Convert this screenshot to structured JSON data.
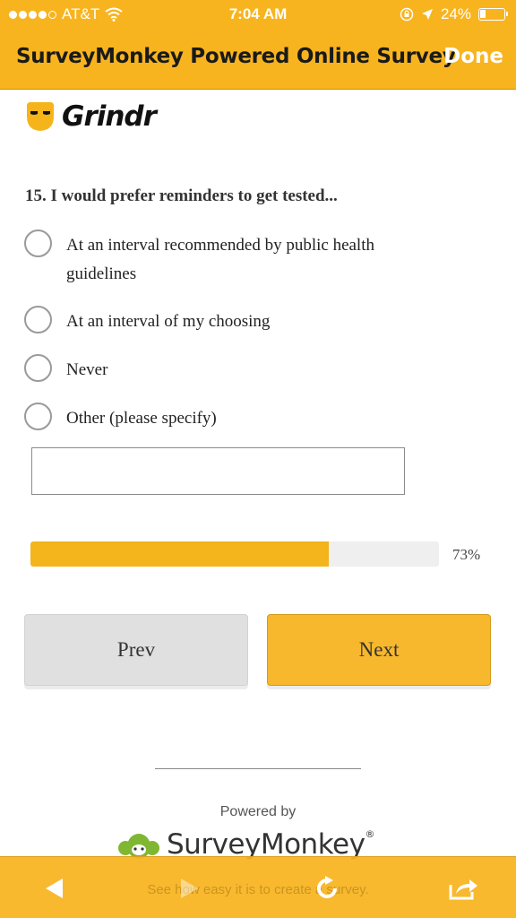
{
  "status_bar": {
    "carrier": "AT&T",
    "time": "7:04 AM",
    "battery_percent": "24%",
    "battery_level": 0.24,
    "signal_dots_filled": 4,
    "signal_dots_total": 5
  },
  "nav": {
    "title": "SurveyMonkey Powered Online Survey",
    "done_label": "Done"
  },
  "brand": {
    "logo_text": "Grindr"
  },
  "survey": {
    "question": "15. I would prefer reminders to get tested...",
    "options": [
      {
        "label": "At an interval recommended by public health guidelines",
        "selected": false
      },
      {
        "label": "At an interval of my choosing",
        "selected": false
      },
      {
        "label": "Never",
        "selected": false
      },
      {
        "label": "Other (please specify)",
        "selected": false
      }
    ],
    "other_input_value": ""
  },
  "progress": {
    "label": "73%",
    "fraction": 0.73
  },
  "buttons": {
    "prev_label": "Prev",
    "next_label": "Next"
  },
  "footer": {
    "powered_by": "Powered by",
    "brand_name": "SurveyMonkey",
    "reg_mark": "®"
  },
  "toolbar": {
    "ghost_text": "See how easy it is to create a survey."
  },
  "icons": {
    "wifi": "wifi-icon",
    "lock_rotation": "lock-rotation-icon",
    "location": "location-arrow-icon",
    "back": "back-arrow-icon",
    "forward": "forward-arrow-icon",
    "reload": "reload-icon",
    "share": "share-icon"
  },
  "colors": {
    "accent": "#f8b41f",
    "progress_fill": "#f3b41c",
    "next_button": "#f8b82d",
    "prev_button": "#e0e0e0",
    "sm_green": "#7fb733"
  }
}
